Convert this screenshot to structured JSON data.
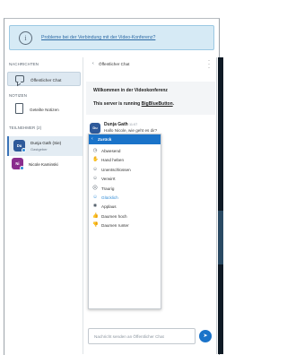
{
  "banner": {
    "text": "Probleme bei der Verbindung mit der Video-Konferenz?"
  },
  "sidebar": {
    "messages_title": "NACHRICHTEN",
    "public_chat_label": "Öffentlicher Chat",
    "notes_title": "NOTIZEN",
    "shared_notes_label": "Geteilte Notizen",
    "participants_title": "TEILNEHMER (2)",
    "users": [
      {
        "initials": "Du",
        "name": "Dunja Gath (Sie)",
        "role": "Gastgeber"
      },
      {
        "initials": "Ni",
        "name": "Nicole Kaminski"
      }
    ]
  },
  "chat": {
    "title": "Öffentlicher Chat",
    "welcome_line1": "Willkommen in der Videokonferenz",
    "welcome_line2_prefix": "This server is running ",
    "welcome_line2_link": "BigBlueButton",
    "welcome_line2_suffix": ".",
    "message": {
      "author_initials": "Du",
      "author": "Dunja Gath",
      "time": "11:07",
      "text": "Hallo Nicole, wie geht es dir?"
    },
    "input_placeholder": "Nachricht senden an Öffentlicher Chat"
  },
  "status_menu": {
    "back_label": "Zurück",
    "items": [
      {
        "label": "Abwesend",
        "icon": "clock-icon",
        "glyph": "◷"
      },
      {
        "label": "Hand heben",
        "icon": "hand-icon",
        "glyph": "✋"
      },
      {
        "label": "Unentschlossen",
        "icon": "undecided-icon",
        "glyph": "☺"
      },
      {
        "label": "Verwirrt",
        "icon": "confused-icon",
        "glyph": "☺"
      },
      {
        "label": "Traurig",
        "icon": "sad-icon",
        "glyph": "☹"
      },
      {
        "label": "Glücklich",
        "icon": "happy-icon",
        "glyph": "☺",
        "active": true
      },
      {
        "label": "Applaus",
        "icon": "applause-icon",
        "glyph": "✺"
      },
      {
        "label": "Daumen hoch",
        "icon": "thumbs-up-icon",
        "glyph": "👍"
      },
      {
        "label": "Daumen runter",
        "icon": "thumbs-down-icon",
        "glyph": "👎"
      }
    ]
  },
  "colors": {
    "accent": "#1a73c9",
    "banner_bg": "#d6eaf5",
    "active_item": "#2c89d6"
  }
}
